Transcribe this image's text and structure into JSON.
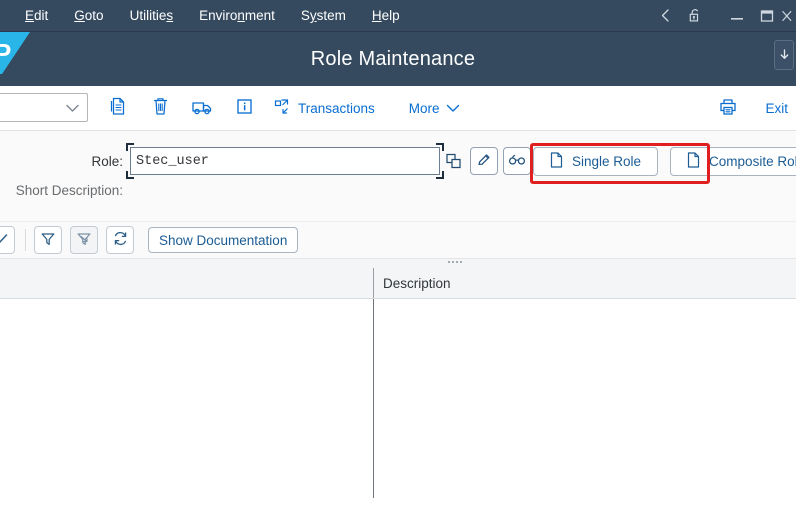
{
  "menubar": {
    "items": [
      {
        "label": "Edit",
        "acc": "E",
        "pre": "",
        "post": "dit"
      },
      {
        "label": "Goto",
        "acc": "G",
        "pre": "",
        "post": "oto"
      },
      {
        "label": "Utilities",
        "acc": "s",
        "pre": "Utilitie",
        "post": ""
      },
      {
        "label": "Environment",
        "acc": "n",
        "pre": "Enviro",
        "post": "ment"
      },
      {
        "label": "System",
        "acc": "y",
        "pre": "S",
        "post": "stem"
      },
      {
        "label": "Help",
        "acc": "H",
        "pre": "",
        "post": "elp"
      }
    ],
    "window_controls": [
      {
        "name": "back-icon",
        "title": "Back"
      },
      {
        "name": "lock-icon",
        "title": "Lock"
      },
      {
        "name": "minimize-icon",
        "title": "Minimize"
      },
      {
        "name": "maximize-icon",
        "title": "Maximize"
      },
      {
        "name": "close-icon",
        "title": "Close"
      }
    ]
  },
  "shellbar": {
    "title": "Role Maintenance",
    "logo_text": "P",
    "collapse_icon": "arrow-down-icon"
  },
  "toolbar": {
    "combo_value": "",
    "combo_placeholder": "",
    "copy_icon": "copy-icon",
    "delete_icon": "trash-icon",
    "transport_icon": "truck-icon",
    "info_icon": "info-icon",
    "transactions_label": "Transactions",
    "more_label": "More",
    "print_icon": "printer-icon",
    "exit_label": "Exit"
  },
  "form": {
    "role_label": "Role:",
    "role_value": "Stec_user",
    "role_placeholder": "",
    "value_help_icon": "value-help-icon",
    "edit_icon": "pencil-icon",
    "display_icon": "glasses-icon",
    "short_description_label": "Short Description:",
    "short_description_value": "",
    "single_role_label": "Single Role",
    "composite_role_label": "Composite Role",
    "highlight_color": "#e02020"
  },
  "subbar": {
    "check_icon": "check-icon",
    "filter_icon": "filter-icon",
    "delete_filter_icon": "filter-off-icon",
    "refresh_icon": "refresh-icon",
    "show_documentation_label": "Show Documentation"
  },
  "table": {
    "columns": [
      "",
      "Description"
    ],
    "rows": []
  },
  "colors": {
    "shell_bg": "#354a5f",
    "accent": "#0a6ed1",
    "logo_cyan": "#29b5e8",
    "highlight": "#e02020"
  }
}
